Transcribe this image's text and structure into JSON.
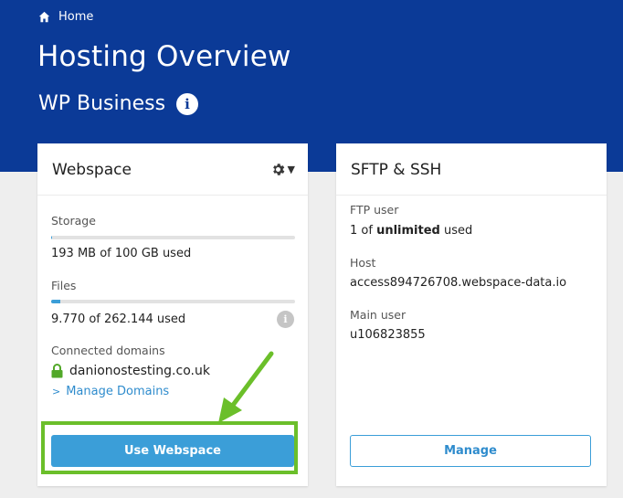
{
  "breadcrumb": {
    "home_label": "Home"
  },
  "page": {
    "title": "Hosting Overview",
    "subtitle": "WP Business"
  },
  "webspace": {
    "title": "Webspace",
    "storage_label": "Storage",
    "storage_value": "193 MB of 100 GB used",
    "storage_fraction": 0.002,
    "files_label": "Files",
    "files_value": "9.770 of 262.144 used",
    "files_fraction": 0.037,
    "domains_label": "Connected domains",
    "domain": "danionostesting.co.uk",
    "manage_domains": "Manage Domains",
    "use_button": "Use Webspace"
  },
  "sftp": {
    "title": "SFTP & SSH",
    "ftp_user_label": "FTP user",
    "ftp_user_prefix": "1 of ",
    "ftp_user_strong": "unlimited",
    "ftp_user_suffix": " used",
    "host_label": "Host",
    "host_value": "access894726708.webspace-data.io",
    "main_user_label": "Main user",
    "main_user_value": "u106823855",
    "manage_button": "Manage"
  },
  "colors": {
    "header_blue": "#0b3a97",
    "accent_blue": "#3b9ed8",
    "highlight_green": "#6bbf2a"
  }
}
